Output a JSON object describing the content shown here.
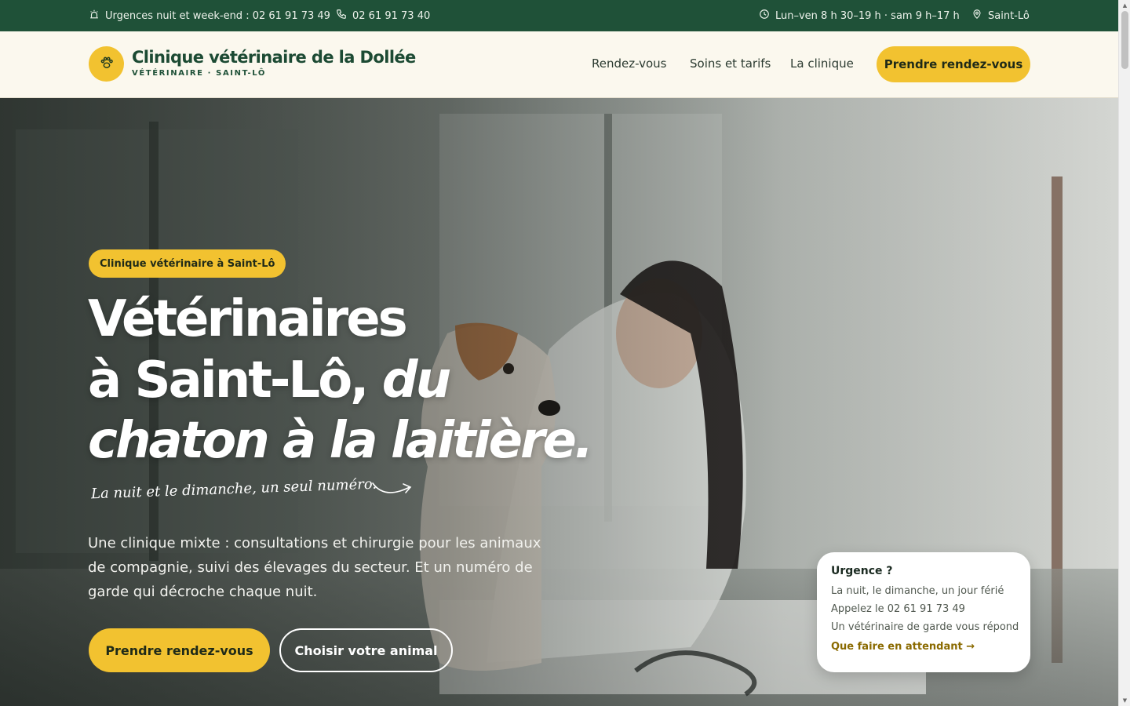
{
  "topbar": {
    "emergency": "Urgences nuit et week-end : 02 61 91 73 49",
    "phone": "02 61 91 73 40",
    "hours": "Lun–ven 8 h 30–19 h · sam 9 h–17 h",
    "location": "Saint-Lô"
  },
  "header": {
    "brand_name": "Clinique vétérinaire de la Dollée",
    "brand_sub": "VÉTÉRINAIRE · SAINT-LÔ",
    "nav": [
      "Rendez-vous",
      "Soins et tarifs",
      "La clinique"
    ],
    "cta": "Prendre rendez-vous"
  },
  "hero": {
    "pill": "Clinique vétérinaire à Saint-Lô",
    "headline_1": "Vétérinaires",
    "headline_2a": "à Saint-Lô, ",
    "headline_2b": "du",
    "headline_3": "chaton à la laitière.",
    "script": "La nuit et le dimanche, un seul numéro.",
    "description": "Une clinique mixte : consultations et chirurgie pour les animaux de compagnie, suivi des élevages du secteur. Et un numéro de garde qui décroche chaque nuit.",
    "btn_primary": "Prendre rendez-vous",
    "btn_secondary": "Choisir votre animal"
  },
  "urgence_card": {
    "title": "Urgence ?",
    "line1": "La nuit, le dimanche, un jour férié",
    "line2": "Appelez le 02 61 91 73 49",
    "line3": "Un vétérinaire de garde vous répond",
    "link": "Que faire en attendant →"
  },
  "colors": {
    "brand_green": "#1f5138",
    "accent_yellow": "#f2c230",
    "cream": "#fbf8ee"
  },
  "icons": [
    "siren-icon",
    "phone-icon",
    "clock-icon",
    "map-pin-icon",
    "paw-icon",
    "arrow-doodle-icon"
  ]
}
